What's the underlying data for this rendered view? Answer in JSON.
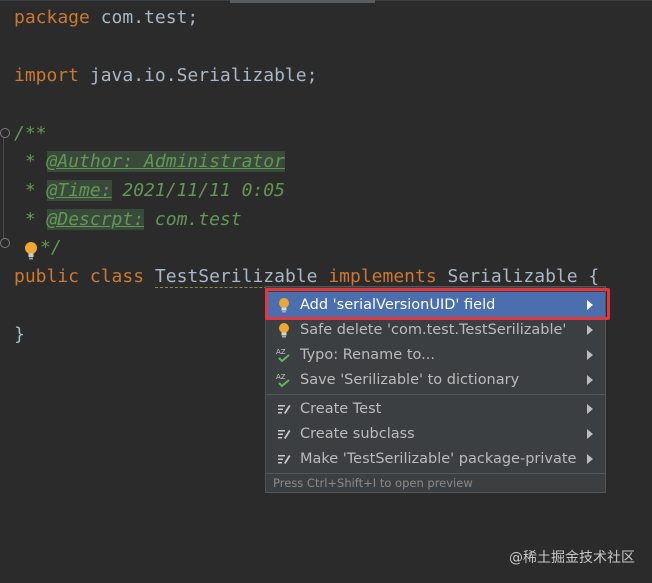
{
  "editor": {
    "line1": {
      "kw": "package",
      "rest": " com.test;"
    },
    "line2": {
      "kw": "import",
      "rest": " java.io.Serializable;"
    },
    "doc_open": "/**",
    "doc_lines": [
      {
        "star": " * ",
        "tag": "@Author:",
        "value": " Administrator"
      },
      {
        "star": " * ",
        "tag": "@Time:",
        "value": " 2021/11/11 0:05"
      },
      {
        "star": " * ",
        "tag": "@Descrpt:",
        "value": " com.test"
      }
    ],
    "doc_close": "*/",
    "class_line": {
      "kw1": "public",
      "kw2": "class",
      "name": "TestSerilizable",
      "kw3": "implements",
      "iface": "Serializable",
      "brace": "{"
    },
    "close_brace": "}"
  },
  "intention_menu": {
    "items": [
      {
        "label": "Add 'serialVersionUID' field",
        "icon": "bulb-icon",
        "selected": true
      },
      {
        "label": "Safe delete 'com.test.TestSerilizable'",
        "icon": "bulb-icon"
      },
      {
        "label": "Typo: Rename to...",
        "icon": "spellcheck-icon"
      },
      {
        "label": "Save 'Serilizable' to dictionary",
        "icon": "spellcheck-icon"
      },
      {
        "label": "Create Test",
        "icon": "edit-icon"
      },
      {
        "label": "Create subclass",
        "icon": "edit-icon"
      },
      {
        "label": "Make 'TestSerilizable' package-private",
        "icon": "edit-icon"
      }
    ],
    "footer": "Press Ctrl+Shift+I to open preview"
  },
  "watermark": "@稀土掘金技术社区",
  "colors": {
    "keyword": "#cc7832",
    "doc": "#629755",
    "selection": "#4b6eaf",
    "highlight": "#e0383e"
  }
}
